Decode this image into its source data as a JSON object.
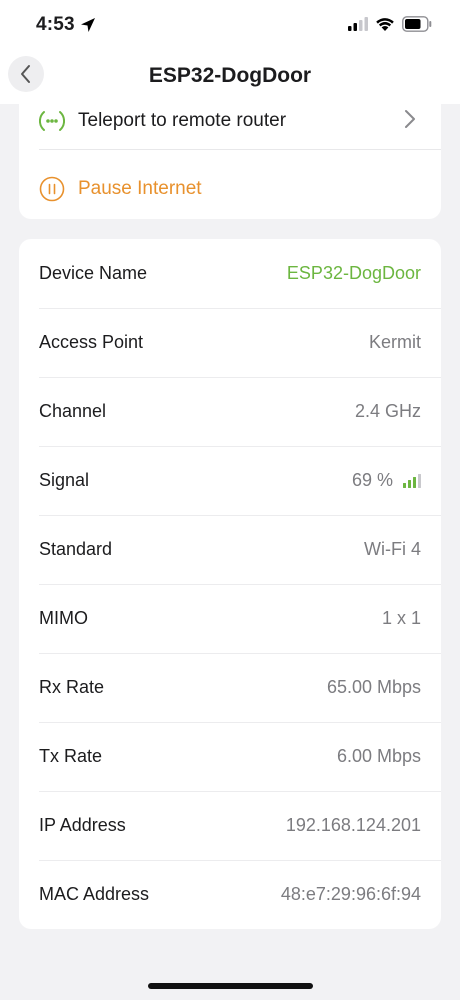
{
  "status_bar": {
    "time": "4:53",
    "icons": [
      "location-arrow-icon",
      "cellular-signal-icon",
      "wifi-icon",
      "battery-icon"
    ]
  },
  "nav": {
    "title": "ESP32-DogDoor",
    "back_icon": "chevron-left-icon"
  },
  "actions": {
    "teleport": {
      "label": "Teleport to remote router",
      "icon": "teleport-icon"
    },
    "pause": {
      "label": "Pause Internet",
      "icon": "pause-circle-icon"
    }
  },
  "device_info": [
    {
      "label": "Device Name",
      "value": "ESP32-DogDoor"
    },
    {
      "label": "Access Point",
      "value": "Kermit"
    },
    {
      "label": "Channel",
      "value": "2.4 GHz"
    },
    {
      "label": "Signal",
      "value": "69 %",
      "signal_bars_lit": 3,
      "signal_bars_total": 4
    },
    {
      "label": "Standard",
      "value": "Wi-Fi 4"
    },
    {
      "label": "MIMO",
      "value": "1 x 1"
    },
    {
      "label": "Rx Rate",
      "value": "65.00 Mbps"
    },
    {
      "label": "Tx Rate",
      "value": "6.00 Mbps"
    },
    {
      "label": "IP Address",
      "value": "192.168.124.201"
    },
    {
      "label": "MAC Address",
      "value": "48:e7:29:96:6f:94"
    }
  ],
  "colors": {
    "accent_green": "#6cb640",
    "pause_orange": "#e8912d",
    "secondary_text": "#7c7c80",
    "background": "#f2f2f4"
  }
}
